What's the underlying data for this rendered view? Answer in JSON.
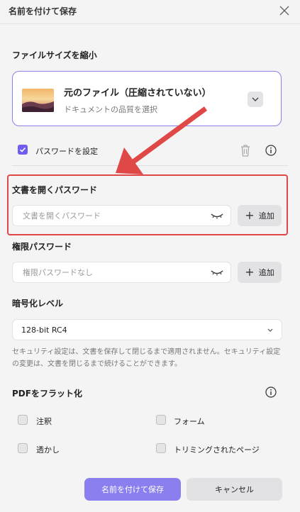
{
  "dialog": {
    "title": "名前を付けて保存"
  },
  "compress": {
    "heading": "ファイルサイズを縮小",
    "option_title": "元のファイル（圧縮されていない）",
    "option_sub": "ドキュメントの品質を選択"
  },
  "password": {
    "set_label": "パスワードを設定",
    "set_checked": true,
    "open_heading": "文書を開くパスワード",
    "open_placeholder": "文書を開くパスワード",
    "perm_heading": "権限パスワード",
    "perm_placeholder": "権限パスワードなし",
    "add_label": "追加"
  },
  "encryption": {
    "heading": "暗号化レベル",
    "selected": "128-bit RC4",
    "note": "セキュリティ設定は、文書を保存して閉じるまで適用されません。セキュリティ設定の変更は、文書を閉じるまで続けることができます。"
  },
  "flatten": {
    "heading": "PDFをフラット化",
    "items": [
      {
        "label": "注釈",
        "checked": false
      },
      {
        "label": "フォーム",
        "checked": false
      },
      {
        "label": "透かし",
        "checked": false
      },
      {
        "label": "トリミングされたページ",
        "checked": false
      }
    ]
  },
  "buttons": {
    "save": "名前を付けて保存",
    "cancel": "キャンセル"
  },
  "colors": {
    "accent": "#8b7ff0",
    "highlight": "#e04848"
  },
  "icons": [
    "close-icon",
    "chevron-down-icon",
    "checkmark-icon",
    "trash-icon",
    "info-icon",
    "eye-hidden-icon",
    "plus-icon"
  ]
}
